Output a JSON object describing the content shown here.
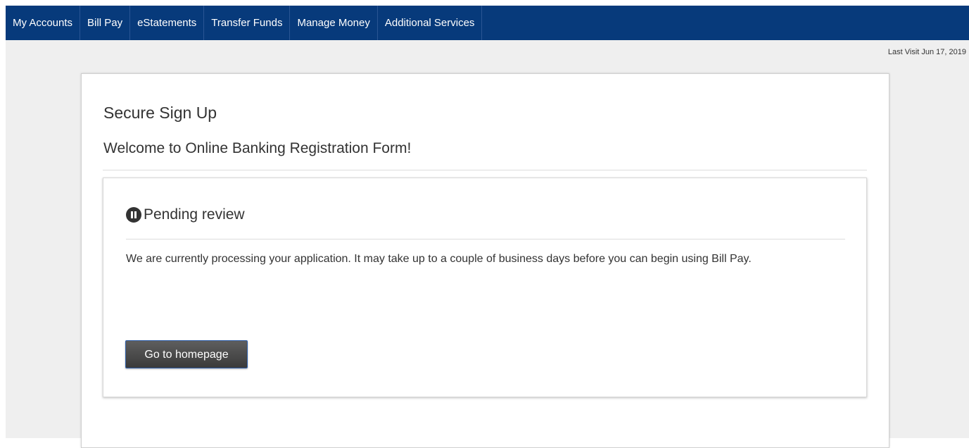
{
  "nav": {
    "items": [
      {
        "label": "My Accounts"
      },
      {
        "label": "Bill Pay"
      },
      {
        "label": "eStatements"
      },
      {
        "label": "Transfer Funds"
      },
      {
        "label": "Manage Money"
      },
      {
        "label": "Additional Services"
      }
    ]
  },
  "header": {
    "last_visit": "Last Visit Jun 17, 2019"
  },
  "card": {
    "title": "Secure Sign Up",
    "subtitle": "Welcome to Online Banking Registration Form!"
  },
  "status": {
    "icon": "pause-circle-icon",
    "title": "Pending review",
    "message": "We are currently processing your application. It may take up to a couple of business days before you can begin using Bill Pay.",
    "button_label": "Go to homepage"
  },
  "colors": {
    "nav_bg": "#073a7b",
    "page_bg": "#efefef",
    "button_bg": "#4a4a4a"
  }
}
